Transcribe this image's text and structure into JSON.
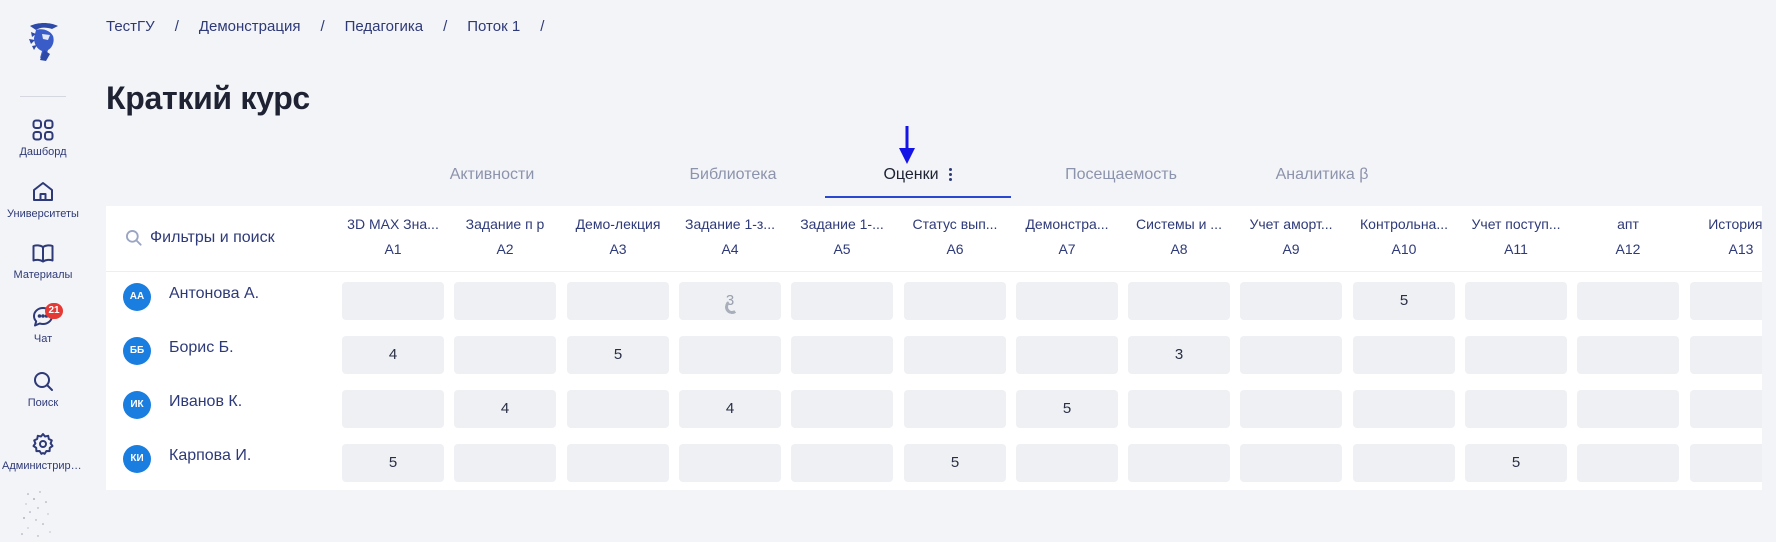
{
  "sidebar": {
    "items": [
      {
        "label": "Дашборд",
        "icon": "dashboard-grid-icon"
      },
      {
        "label": "Университеты",
        "icon": "university-house-icon"
      },
      {
        "label": "Материалы",
        "icon": "book-icon"
      },
      {
        "label": "Чат",
        "icon": "chat-bubble-icon",
        "badge": "21"
      },
      {
        "label": "Поиск",
        "icon": "search-icon"
      },
      {
        "label": "Администрирование",
        "icon": "gear-icon"
      }
    ]
  },
  "breadcrumb": [
    "ТестГУ",
    "Демонстрация",
    "Педагогика",
    "Поток 1"
  ],
  "breadcrumb_separator": "/",
  "page_title": "Краткий курс",
  "tabs": [
    {
      "label": "Активности"
    },
    {
      "label": "Библиотека"
    },
    {
      "label": "Оценки",
      "active": true
    },
    {
      "label": "Посещаемость"
    },
    {
      "label": "Аналитика β"
    }
  ],
  "grades": {
    "search_placeholder": "Фильтры и поиск",
    "columns": [
      {
        "title": "3D MAX Зна...",
        "code": "А1"
      },
      {
        "title": "Задание п р",
        "code": "А2"
      },
      {
        "title": "Демо-лекция",
        "code": "А3"
      },
      {
        "title": "Задание 1-з...",
        "code": "А4"
      },
      {
        "title": "Задание 1-...",
        "code": "А5"
      },
      {
        "title": "Статус вып...",
        "code": "А6"
      },
      {
        "title": "Демонстра...",
        "code": "А7"
      },
      {
        "title": "Системы и ...",
        "code": "А8"
      },
      {
        "title": "Учет аморт...",
        "code": "А9"
      },
      {
        "title": "Контрольна...",
        "code": "А10"
      },
      {
        "title": "Учет поступ...",
        "code": "А11"
      },
      {
        "title": "апт",
        "code": "А12"
      },
      {
        "title": "История в",
        "code": "А13"
      }
    ],
    "students": [
      {
        "initials": "АА",
        "name": "Антонова А.",
        "grades": [
          "",
          "",
          "",
          "3",
          "",
          "",
          "",
          "",
          "",
          "5",
          "",
          "",
          ""
        ]
      },
      {
        "initials": "ББ",
        "name": "Борис Б.",
        "grades": [
          "4",
          "",
          "5",
          "",
          "",
          "",
          "",
          "3",
          "",
          "",
          "",
          "",
          ""
        ]
      },
      {
        "initials": "ИК",
        "name": "Иванов К.",
        "grades": [
          "",
          "4",
          "",
          "4",
          "",
          "",
          "5",
          "",
          "",
          "",
          "",
          "",
          ""
        ]
      },
      {
        "initials": "КИ",
        "name": "Карпова И.",
        "grades": [
          "5",
          "",
          "",
          "",
          "",
          "5",
          "",
          "",
          "",
          "",
          "5",
          "",
          ""
        ]
      }
    ]
  },
  "colors": {
    "accent": "#2947d1",
    "avatar": "#1a7de0",
    "badge": "#e53935",
    "arrow_annotation": "#1414e6"
  }
}
